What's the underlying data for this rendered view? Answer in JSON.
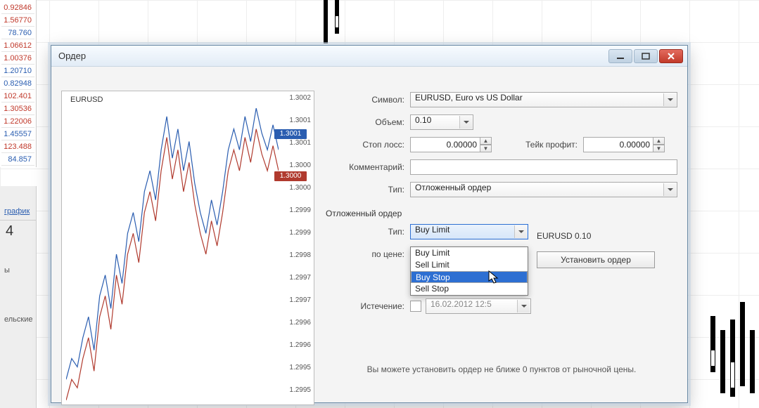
{
  "bg_prices": [
    {
      "v": "0.92846",
      "cls": "red"
    },
    {
      "v": "1.56770",
      "cls": "red"
    },
    {
      "v": "78.760",
      "cls": "blue"
    },
    {
      "v": "1.06612",
      "cls": "red"
    },
    {
      "v": "1.00376",
      "cls": "red"
    },
    {
      "v": "1.20710",
      "cls": "blue"
    },
    {
      "v": "0.82948",
      "cls": "blue"
    },
    {
      "v": "102.401",
      "cls": "red"
    },
    {
      "v": "1.30536",
      "cls": "red"
    },
    {
      "v": "1.22006",
      "cls": "red"
    },
    {
      "v": "1.45557",
      "cls": "blue"
    },
    {
      "v": "123.488",
      "cls": "red"
    },
    {
      "v": "84.857",
      "cls": "blue"
    }
  ],
  "sidebar": {
    "link": "график",
    "big": "4",
    "item2": "ы",
    "item3": "ельские"
  },
  "dialog": {
    "title": "Ордер",
    "chart_symbol": "EURUSD",
    "labels": {
      "symbol": "Символ:",
      "volume": "Объем:",
      "stoploss": "Стоп лосс:",
      "takeprofit": "Тейк профит:",
      "comment": "Комментарий:",
      "type": "Тип:",
      "pending_section": "Отложенный ордер",
      "pending_type": "Тип:",
      "at_price": "по цене:",
      "expiry": "Истечение:"
    },
    "values": {
      "symbol": "EURUSD, Euro vs US Dollar",
      "volume": "0.10",
      "stoploss": "0.00000",
      "takeprofit": "0.00000",
      "type": "Отложенный ордер",
      "pending_type": "Buy Limit",
      "lot_display": "EURUSD 0.10",
      "expiry": "16.02.2012  12:5"
    },
    "pending_options": [
      "Buy Limit",
      "Sell Limit",
      "Buy Stop",
      "Sell Stop"
    ],
    "pending_selected_index": 2,
    "place_button": "Установить ордер",
    "footer": "Вы можете установить ордер не ближе 0 пунктов от рыночной цены."
  },
  "chart_data": {
    "type": "line",
    "title": "EURUSD",
    "ylim": [
      1.2995,
      1.3002
    ],
    "y_ticks": [
      "1.3002",
      "1.3001",
      "1.3001",
      "1.3000",
      "1.3000",
      "1.2999",
      "1.2999",
      "1.2998",
      "1.2997",
      "1.2997",
      "1.2996",
      "1.2996",
      "1.2995",
      "1.2995"
    ],
    "ask_tag": "1.3001",
    "bid_tag": "1.3000",
    "series": [
      {
        "name": "ask",
        "color": "#2a5db0",
        "values": [
          1.29955,
          1.2996,
          1.29958,
          1.29965,
          1.2997,
          1.29962,
          1.29975,
          1.2998,
          1.29972,
          1.29985,
          1.29978,
          1.2999,
          1.29995,
          1.29988,
          1.3,
          1.30005,
          1.29998,
          1.3001,
          1.30018,
          1.30008,
          1.30015,
          1.30005,
          1.30012,
          1.30002,
          1.29995,
          1.2999,
          1.29998,
          1.29992,
          1.3,
          1.3001,
          1.30015,
          1.3001,
          1.30018,
          1.30012,
          1.3002,
          1.30014,
          1.3001,
          1.30016,
          1.3001
        ]
      },
      {
        "name": "bid",
        "color": "#b03a2e",
        "values": [
          1.2995,
          1.29955,
          1.29953,
          1.2996,
          1.29965,
          1.29957,
          1.2997,
          1.29975,
          1.29967,
          1.2998,
          1.29973,
          1.29985,
          1.2999,
          1.29983,
          1.29995,
          1.3,
          1.29993,
          1.30005,
          1.30013,
          1.30003,
          1.3001,
          1.3,
          1.30007,
          1.29997,
          1.2999,
          1.29985,
          1.29993,
          1.29987,
          1.29995,
          1.30005,
          1.3001,
          1.30005,
          1.30013,
          1.30007,
          1.30015,
          1.30009,
          1.30005,
          1.30011,
          1.30005
        ]
      }
    ]
  }
}
